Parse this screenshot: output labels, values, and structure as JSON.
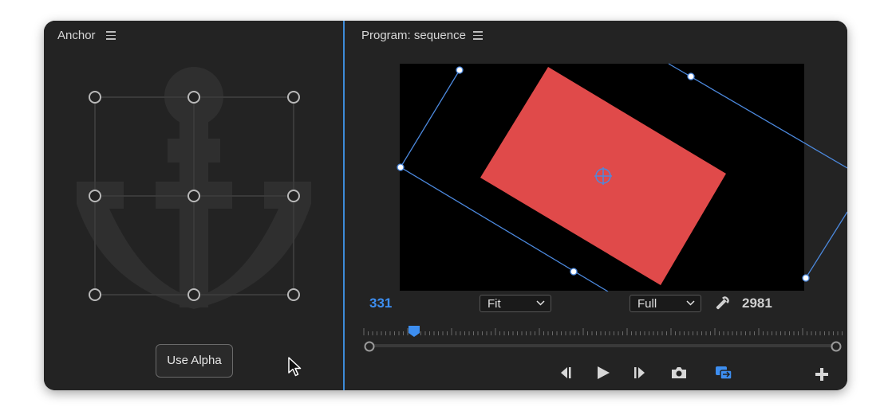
{
  "left_panel": {
    "title": "Anchor",
    "menu_icon": "hamburger-menu-icon",
    "use_alpha_label": "Use Alpha"
  },
  "right_panel": {
    "title": "Program: sequence",
    "menu_icon": "hamburger-menu-icon",
    "timecode_current": "331",
    "timecode_duration": "2981",
    "fit_select": {
      "value": "Fit"
    },
    "quality_select": {
      "value": "Full"
    },
    "clip_color": "#e04a4a",
    "accent_color": "#3d8ef0",
    "controls": [
      "step-back-icon",
      "play-icon",
      "step-forward-icon",
      "camera-icon",
      "toggle-proxy-icon",
      "add-icon"
    ]
  }
}
